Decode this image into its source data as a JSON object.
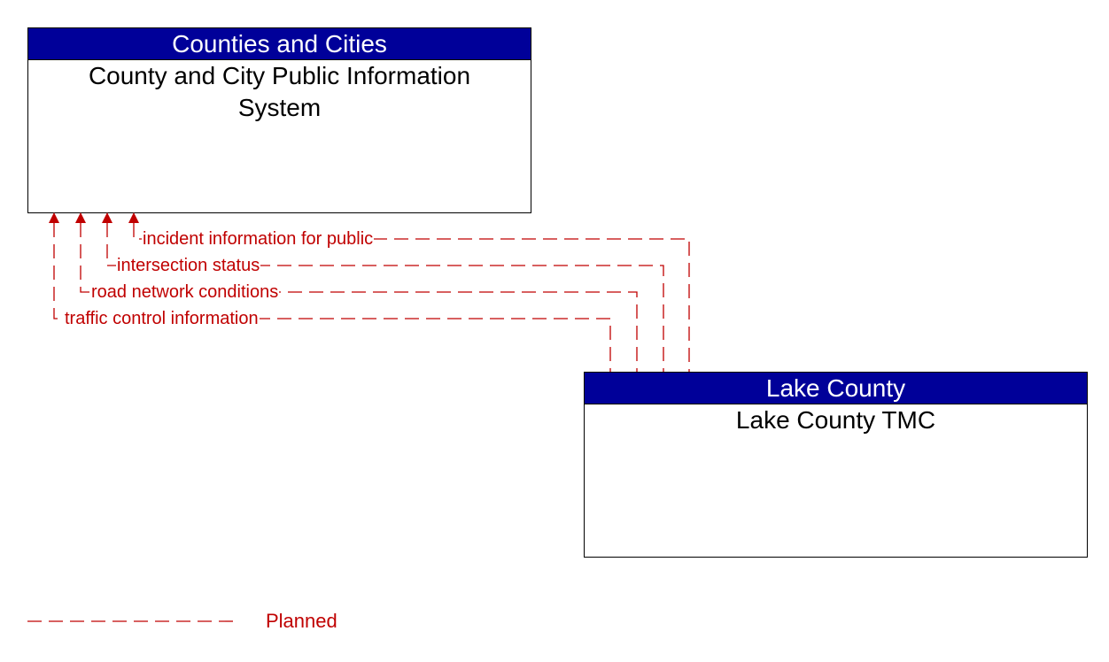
{
  "diagram": {
    "nodes": [
      {
        "id": "box1",
        "group": "Counties and Cities",
        "name": "County and City Public Information System"
      },
      {
        "id": "box2",
        "group": "Lake County",
        "name": "Lake County TMC"
      }
    ],
    "flows": [
      {
        "label": "incident information for public",
        "from": "Lake County TMC",
        "to": "County and City Public Information System",
        "status": "Planned"
      },
      {
        "label": "intersection status",
        "from": "Lake County TMC",
        "to": "County and City Public Information System",
        "status": "Planned"
      },
      {
        "label": "road network conditions",
        "from": "Lake County TMC",
        "to": "County and City Public Information System",
        "status": "Planned"
      },
      {
        "label": "traffic control information",
        "from": "Lake County TMC",
        "to": "County and City Public Information System",
        "status": "Planned"
      }
    ],
    "legend": {
      "label": "Planned",
      "color": "#c00000",
      "style": "dashed"
    },
    "colors": {
      "header": "#000099",
      "flow": "#c00000"
    }
  }
}
